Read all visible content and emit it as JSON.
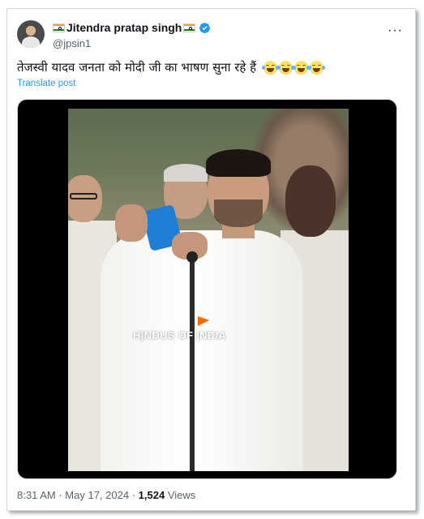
{
  "author": {
    "display_name": "Jitendra pratap singh",
    "handle": "@jpsin1",
    "verified": true,
    "flags": [
      "india-flag",
      "india-flag"
    ]
  },
  "more_menu": {
    "label": "···"
  },
  "tweet": {
    "text": "तेजस्वी यादव जनता को मोदी जी का भाषण सुना रहे हैं",
    "emojis": [
      "face-with-tears-of-joy",
      "face-with-tears-of-joy",
      "face-with-tears-of-joy",
      "face-with-tears-of-joy"
    ],
    "translate_label": "Translate post"
  },
  "media": {
    "watermark": "H|NDUS OF |NDIA"
  },
  "meta": {
    "time": "8:31 AM",
    "separator": "·",
    "date": "May 17, 2024",
    "views_count": "1,524",
    "views_label": "Views"
  },
  "colors": {
    "link": "#1d9bf0",
    "secondary_text": "#536471",
    "primary_text": "#0f1419",
    "verified": "#1d9bf0"
  }
}
